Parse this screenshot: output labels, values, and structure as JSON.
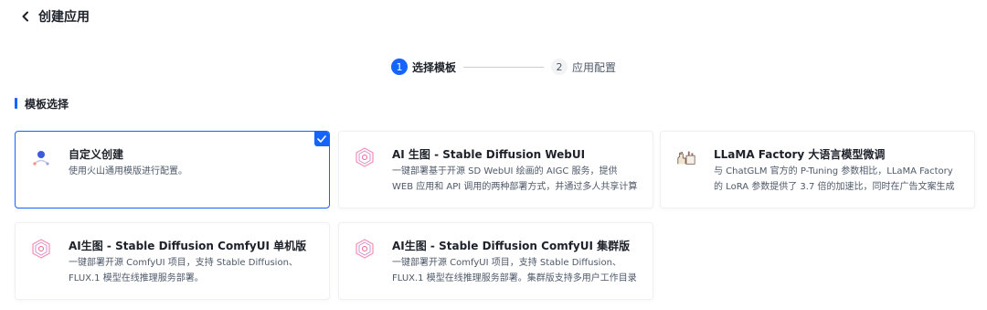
{
  "header": {
    "title": "创建应用"
  },
  "stepper": {
    "steps": [
      {
        "num": "1",
        "label": "选择模板"
      },
      {
        "num": "2",
        "label": "应用配置"
      }
    ]
  },
  "section": {
    "title": "模板选择"
  },
  "cards": [
    {
      "title": "自定义创建",
      "desc": "使用火山通用模版进行配置。",
      "icon": "custom-create-icon",
      "selected": true
    },
    {
      "title": "AI 生图 - Stable Diffusion WebUI",
      "desc": "一键部署基于开源 SD WebUI 绘画的 AIGC 服务，提供 WEB 应用和 API 调用的两种部署方式，并通过多人共享计算资源，提升资源利用率。",
      "icon": "stable-diffusion-icon"
    },
    {
      "title": "LLaMA Factory 大语言模型微调",
      "desc": "与 ChatGLM 官方的 P-Tuning 参数相比，LLaMA Factory 的 LoRA 参数提供了 3.7 倍的加速比，同时在广告文案生成任务上取得了更高的分数。",
      "icon": "llama-icon"
    },
    {
      "title": "AI生图 - Stable Diffusion ComfyUI 单机版",
      "desc": "一键部署开源 ComfyUI 项目，支持 Stable Diffusion、FLUX.1 模型在线推理服务部署。",
      "icon": "stable-diffusion-icon"
    },
    {
      "title": "AI生图 - Stable Diffusion ComfyUI 集群版",
      "desc": "一键部署开源 ComfyUI 项目，支持 Stable Diffusion、FLUX.1 模型在线推理服务部署。集群版支持多用户工作目录隔离，共享模型文件。",
      "icon": "stable-diffusion-icon"
    }
  ],
  "colors": {
    "accent": "#1664ff",
    "text": "#1d2129",
    "muted": "#4e5969"
  }
}
